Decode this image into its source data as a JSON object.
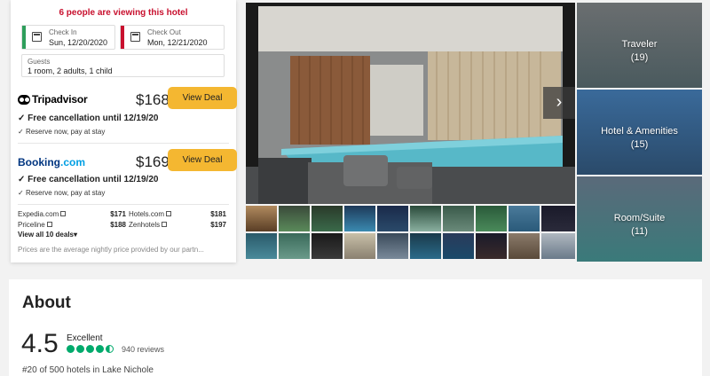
{
  "booking": {
    "viewing_text": "6 people are viewing this hotel",
    "check_in": {
      "label": "Check In",
      "value": "Sun, 12/20/2020",
      "color": "#2e9e5b"
    },
    "check_out": {
      "label": "Check Out",
      "value": "Mon, 12/21/2020",
      "color": "#c8102e"
    },
    "guests": {
      "label": "Guests",
      "value": "1 room, 2 adults, 1 child"
    },
    "offers": [
      {
        "provider": "Tripadvisor",
        "price": "$168",
        "button": "View Deal",
        "free_cancel": "Free cancellation until 12/19/20",
        "reserve": "Reserve now, pay at stay"
      },
      {
        "provider_main": "Booking",
        "provider_suffix": ".com",
        "price": "$169",
        "button": "View Deal",
        "free_cancel": "Free cancellation until 12/19/20",
        "reserve": "Reserve now, pay at stay"
      }
    ],
    "other_deals": [
      {
        "name": "Expedia.com",
        "price": "$171"
      },
      {
        "name": "Hotels.com",
        "price": "$181"
      },
      {
        "name": "Priceline",
        "price": "$188"
      },
      {
        "name": "Zenhotels",
        "price": "$197"
      }
    ],
    "view_all": "View all 10 deals",
    "note": "Prices are the average nightly price provided by our partn..."
  },
  "gallery": {
    "next_icon": "chevron-right-icon",
    "categories": [
      {
        "name": "Traveler",
        "count": "(19)"
      },
      {
        "name": "Hotel & Amenities",
        "count": "(15)"
      },
      {
        "name": "Room/Suite",
        "count": "(11)"
      }
    ]
  },
  "about": {
    "title": "About",
    "score": "4.5",
    "rating_word": "Excellent",
    "bubbles": 4.5,
    "reviews": "940 reviews",
    "rank": "#20 of 500 hotels in Lake Nichole"
  },
  "colors": {
    "accent": "#f4b731",
    "alert": "#c8102e",
    "rating": "#00aa6c"
  }
}
